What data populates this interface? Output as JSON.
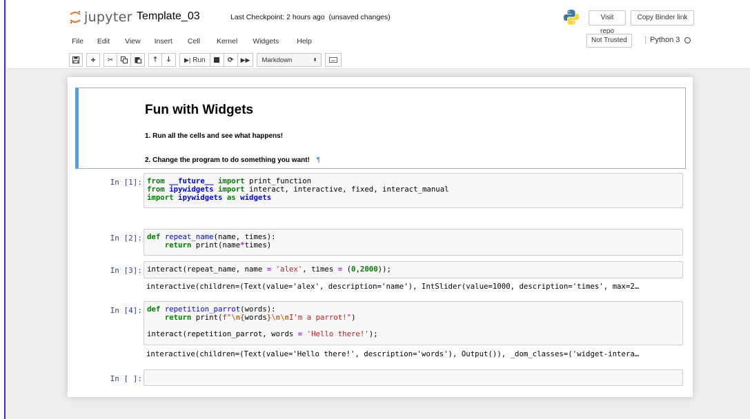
{
  "header": {
    "logo_text": "jupyter",
    "notebook_title": "Template_03",
    "checkpoint": "Last Checkpoint: 2 hours ago",
    "unsaved": "(unsaved changes)",
    "visit_repo": "Visit repo",
    "copy_binder": "Copy Binder link"
  },
  "menu": [
    "File",
    "Edit",
    "View",
    "Insert",
    "Cell",
    "Kernel",
    "Widgets",
    "Help"
  ],
  "status": {
    "trusted": "Not Trusted",
    "kernel": "Python 3"
  },
  "toolbar": {
    "run_label": "Run",
    "cell_type": "Markdown",
    "icons": [
      "save-icon",
      "plus-icon",
      "scissors-icon",
      "copy-icon",
      "paste-icon",
      "arrow-up-icon",
      "arrow-down-icon",
      "run-icon",
      "stop-icon",
      "restart-icon",
      "fast-forward-icon",
      "keyboard-icon"
    ]
  },
  "markdown_cell": {
    "title": "Fun with Widgets",
    "line1": "1. Run all the cells and see what happens!",
    "line2": "2. Change the program to do something you want!",
    "pilcrow": "¶"
  },
  "cells": [
    {
      "prompt": "In [1]:"
    },
    {
      "prompt": "In [2]:"
    },
    {
      "prompt": "In [3]:",
      "output": "interactive(children=(Text(value='alex', description='name'), IntSlider(value=1000, description='times', max=2…"
    },
    {
      "prompt": "In [4]:",
      "output": "interactive(children=(Text(value='Hello there!', description='words'), Output()), _dom_classes=('widget-intera…"
    },
    {
      "prompt": "In [ ]:"
    }
  ],
  "colors": {
    "accent_blue": "#42a5f5",
    "prompt_blue": "#303f9f",
    "keyword_green": "#008000",
    "string_red": "#ba2121"
  }
}
